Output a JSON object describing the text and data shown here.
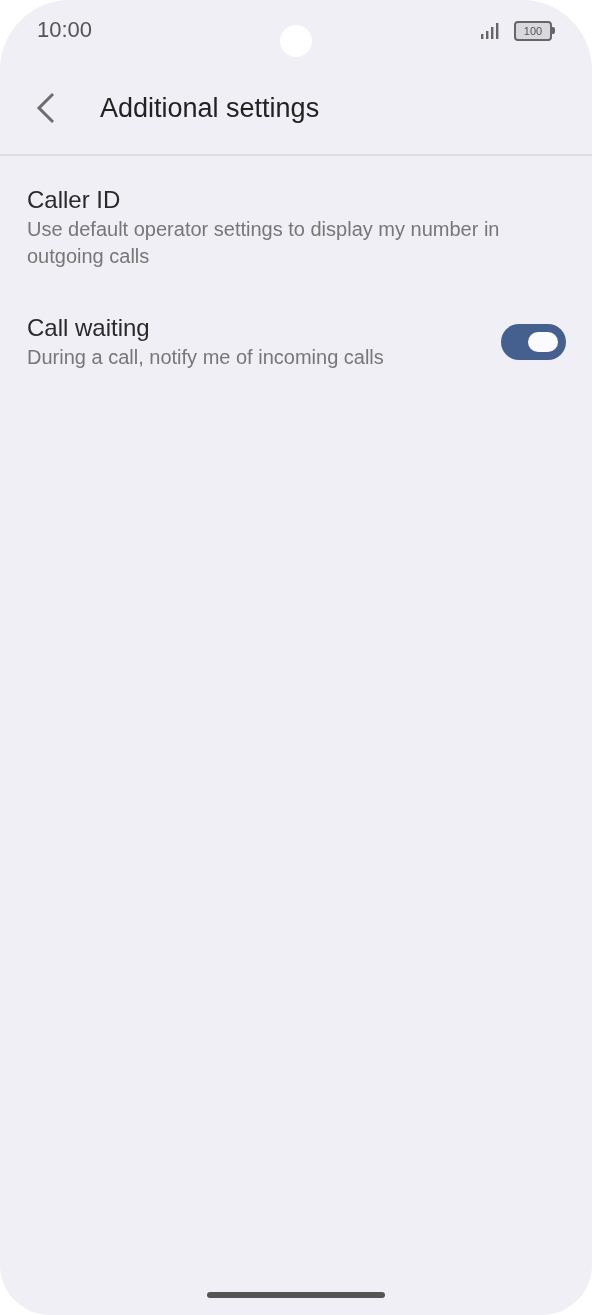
{
  "status_bar": {
    "time": "10:00",
    "battery": "100"
  },
  "header": {
    "title": "Additional settings"
  },
  "settings": [
    {
      "kind": "plain",
      "title": "Caller ID",
      "subtitle": "Use default operator settings to display my number in outgoing calls"
    },
    {
      "kind": "switch",
      "title": "Call waiting",
      "subtitle": "During a call, notify me of incoming calls",
      "on": true
    }
  ]
}
